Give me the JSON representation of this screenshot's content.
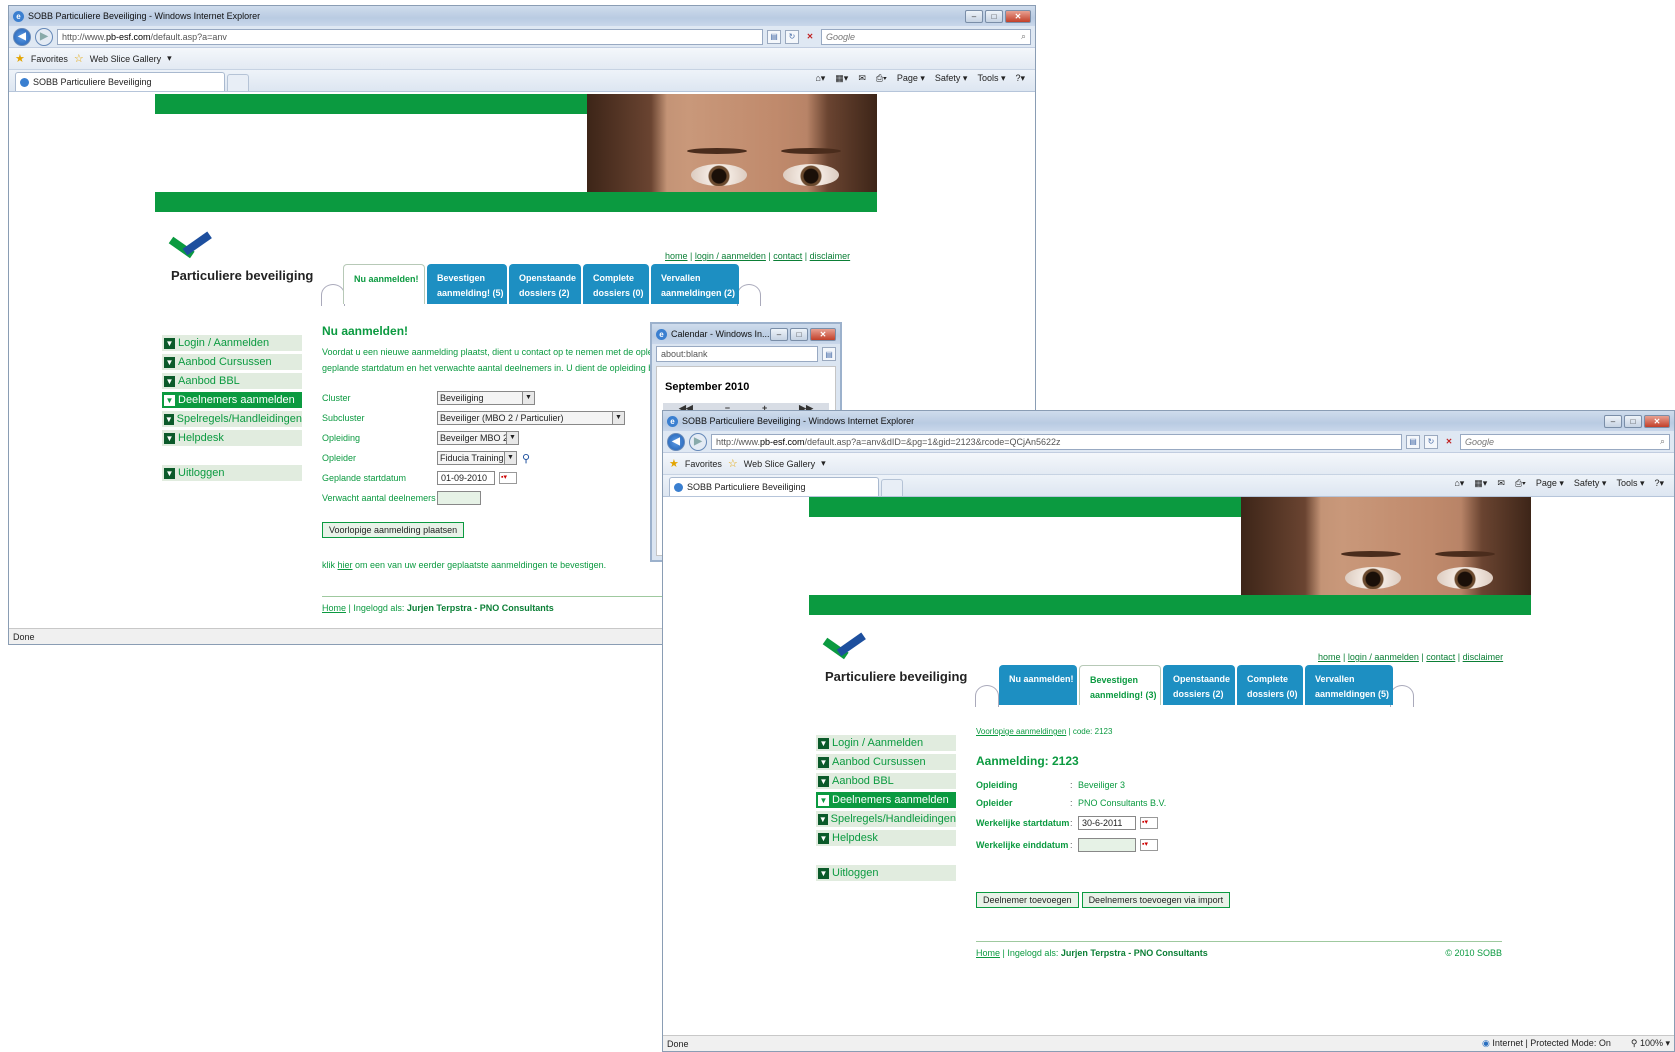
{
  "window1": {
    "title": "SOBB Particuliere Beveiliging - Windows Internet Explorer",
    "url_prefix": "http://www.",
    "url_domain": "pb-esf.com",
    "url_path": "/default.asp?a=anv",
    "search_placeholder": "Google",
    "favorites": "Favorites",
    "web_slice": "Web Slice Gallery",
    "tab_title": "SOBB Particuliere Beveiliging",
    "cmd": {
      "page": "Page ▾",
      "safety": "Safety ▾",
      "tools": "Tools ▾"
    },
    "status": "Done",
    "site": {
      "brand": "Particuliere beveiliging",
      "toplinks": {
        "home": "home",
        "login": "login / aanmelden",
        "contact": "contact",
        "disclaimer": "disclaimer"
      },
      "tabs": [
        {
          "l1": "Nu aanmelden!",
          "l2": ""
        },
        {
          "l1": "Bevestigen",
          "l2": "aanmelding! (5)"
        },
        {
          "l1": "Openstaande",
          "l2": "dossiers (2)"
        },
        {
          "l1": "Complete",
          "l2": "dossiers (0)"
        },
        {
          "l1": "Vervallen",
          "l2": "aanmeldingen (2)"
        }
      ],
      "nav": [
        "Login / Aanmelden",
        "Aanbod Cursussen",
        "Aanbod BBL",
        "Deelnemers aanmelden",
        "Spelregels/Handleidingen",
        "Helpdesk",
        "Uitloggen"
      ],
      "heading": "Nu aanmelden!",
      "intro1": "Voordat u een nieuwe aanmelding plaatst, dient u contact op te nemen met de opleid",
      "intro2": "geplande startdatum en het verwachte aantal deelnemers in. U dient de opleiding b",
      "form": {
        "cluster_label": "Cluster",
        "cluster_value": "Beveiliging",
        "subcluster_label": "Subcluster",
        "subcluster_value": "Beveiliger (MBO 2 / Particulier)",
        "opleiding_label": "Opleiding",
        "opleiding_value": "Beveilger MBO 2",
        "opleider_label": "Opleider",
        "opleider_value": "Fiducia Training",
        "startdatum_label": "Geplande startdatum",
        "startdatum_value": "01-09-2010",
        "aantal_label": "Verwacht aantal deelnemers",
        "aantal_value": ""
      },
      "submit": "Voorlopige aanmelding plaatsen",
      "link_pre": "klik ",
      "link_here": "hier",
      "link_post": " om een van uw eerder geplaatste aanmeldingen te bevestigen.",
      "footer_home": "Home",
      "footer_sep": " | Ingelogd als: ",
      "footer_user": "Jurjen Terpstra - PNO Consultants"
    }
  },
  "calendar": {
    "title": "Calendar - Windows In...",
    "url": "about:blank",
    "month": "September 2010",
    "nav": [
      "◀◀",
      "−",
      "+",
      "▶▶"
    ]
  },
  "window2": {
    "title": "SOBB Particuliere Beveiliging - Windows Internet Explorer",
    "url_prefix": "http://www.",
    "url_domain": "pb-esf.com",
    "url_path": "/default.asp?a=anv&dID=&pg=1&gid=2123&rcode=QCjAn5622z",
    "search_placeholder": "Google",
    "favorites": "Favorites",
    "web_slice": "Web Slice Gallery",
    "tab_title": "SOBB Particuliere Beveiliging",
    "cmd": {
      "page": "Page ▾",
      "safety": "Safety ▾",
      "tools": "Tools ▾"
    },
    "status": "Done",
    "status_zone": "Internet | Protected Mode: On",
    "zoom": "100%",
    "site": {
      "brand": "Particuliere beveiliging",
      "toplinks": {
        "home": "home",
        "login": "login / aanmelden",
        "contact": "contact",
        "disclaimer": "disclaimer"
      },
      "tabs": [
        {
          "l1": "Nu aanmelden!",
          "l2": ""
        },
        {
          "l1": "Bevestigen",
          "l2": "aanmelding! (3)"
        },
        {
          "l1": "Openstaande",
          "l2": "dossiers (2)"
        },
        {
          "l1": "Complete",
          "l2": "dossiers (0)"
        },
        {
          "l1": "Vervallen",
          "l2": "aanmeldingen (5)"
        }
      ],
      "nav": [
        "Login / Aanmelden",
        "Aanbod Cursussen",
        "Aanbod BBL",
        "Deelnemers aanmelden",
        "Spelregels/Handleidingen",
        "Helpdesk",
        "Uitloggen"
      ],
      "breadcrumb_link": "Voorlopige aanmeldingen",
      "breadcrumb_rest": " | code: 2123",
      "heading": "Aanmelding: 2123",
      "opleiding_label": "Opleiding",
      "opleiding_value": "Beveiliger 3",
      "opleider_label": "Opleider",
      "opleider_value": "PNO Consultants B.V.",
      "start_label": "Werkelijke startdatum",
      "start_value": "30-6-2011",
      "eind_label": "Werkelijke einddatum",
      "eind_value": "",
      "btn_add": "Deelnemer toevoegen",
      "btn_import": "Deelnemers toevoegen via import",
      "footer_home": "Home",
      "footer_sep": " | Ingelogd als: ",
      "footer_user": "Jurjen Terpstra - PNO Consultants",
      "copyright": "© 2010 SOBB"
    }
  }
}
